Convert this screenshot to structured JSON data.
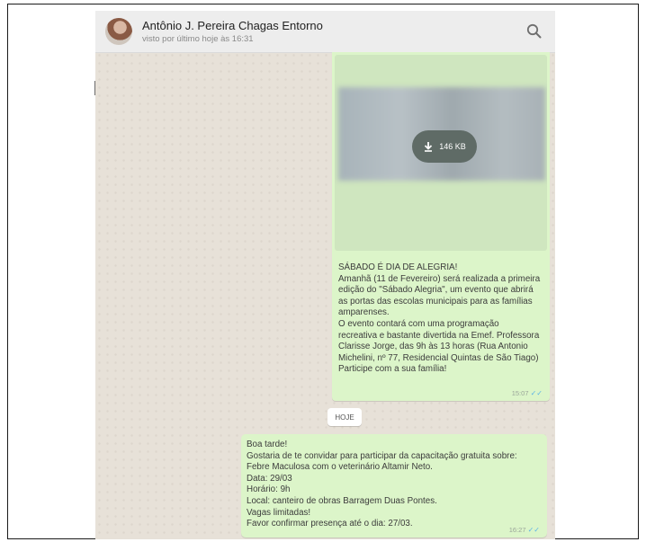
{
  "header": {
    "contact_name": "Antônio J. Pereira Chagas Entorno",
    "status": "visto por último hoje às 16:31",
    "search_icon": "search-icon"
  },
  "messages": [
    {
      "type": "media",
      "media": {
        "download_label": "146 KB",
        "icon": "download-icon"
      },
      "text": "SÁBADO É DIA DE ALEGRIA!\nAmanhã (11 de Fevereiro) será realizada a primeira\nedição do \"Sábado Alegria\", um evento que abrirá\nas portas das escolas municipais para as famílias\namparenses.\nO evento contará com uma programação\nrecreativa e bastante divertida na Emef. Professora\nClarisse Jorge, das 9h às 13 horas (Rua Antonio\nMichelini, nº 77, Residencial Quintas de São Tiago)\nParticipe com a sua família!",
      "time": "15:07",
      "ticks": "✓✓"
    },
    {
      "type": "day_separator",
      "label": "HOJE"
    },
    {
      "type": "text",
      "text": "Boa tarde!\nGostaria de te convidar para participar da capacitação gratuita sobre:\nFebre Maculosa com o veterinário Altamir Neto.\nData: 29/03\nHorário: 9h\nLocal: canteiro de obras Barragem Duas Pontes.\nVagas limitadas!\nFavor confirmar presença até o dia: 27/03.",
      "time": "16:27",
      "ticks": "✓✓"
    }
  ],
  "colors": {
    "chat_background": "#e7e1d8",
    "header_background": "#ededed",
    "outgoing_bubble": "#dcf5c9",
    "read_ticks": "#5cb4e6"
  }
}
